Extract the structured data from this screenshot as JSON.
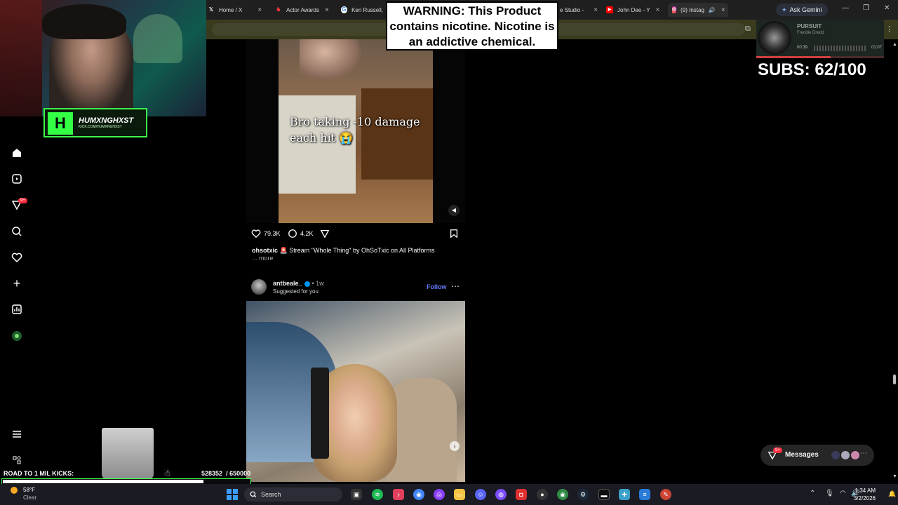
{
  "browser": {
    "tabs": [
      {
        "label": "Home / X",
        "favicon": "X"
      },
      {
        "label": "Actor Awards",
        "favicon": "actor-awards-icon"
      },
      {
        "label": "Keri Russell,",
        "favicon": "google-icon"
      },
      {
        "label": "e Studio -",
        "favicon": ""
      },
      {
        "label": "John Dee - Y",
        "favicon": "youtube-icon"
      },
      {
        "label": "(9) Instag",
        "favicon": "instagram-icon"
      }
    ],
    "ask_gemini": "Ask Gemini"
  },
  "webcam": {
    "badge_name": "HUMXNGHXST",
    "badge_logo": "H",
    "badge_sub": "KICK.COM/HUMXNGHXST"
  },
  "warning": {
    "text": "WARNING: This Product contains nicotine. Nicotine is an addictive chemical."
  },
  "music": {
    "title": "PURSUIT",
    "artist": "Freddie Dredd",
    "elapsed": "00:39",
    "duration": "01:07",
    "progress": 0.58
  },
  "subs": {
    "text": "SUBS: 62/100"
  },
  "post1": {
    "overlay_caption": "Bro taking -10 damage each hit 😭",
    "likes": "79.3K",
    "comments": "4.2K",
    "username": "ohsotxic",
    "caption": "🚨 Stream \"Whole Thing\" by OhSoTxic on All Platforms",
    "more": "... more"
  },
  "post2": {
    "username": "antbeale_",
    "time": "• 1w",
    "suggested": "Suggested for you",
    "follow": "Follow"
  },
  "nav": {
    "notifications_badge": "9+"
  },
  "messages": {
    "label": "Messages",
    "badge": "9+"
  },
  "road": {
    "label": "ROAD TO 1 MIL KICKS:",
    "current": "528352",
    "goal": "/ 650000",
    "progress": 0.8128
  },
  "taskbar": {
    "temp": "58°F",
    "condition": "Clear",
    "search_placeholder": "Search",
    "time": "1:34 AM",
    "date": "3/2/2026"
  },
  "colors": {
    "accent_follow": "#6a7cff",
    "badge_red": "#ff3040",
    "overlay_green": "#3cff4c"
  }
}
